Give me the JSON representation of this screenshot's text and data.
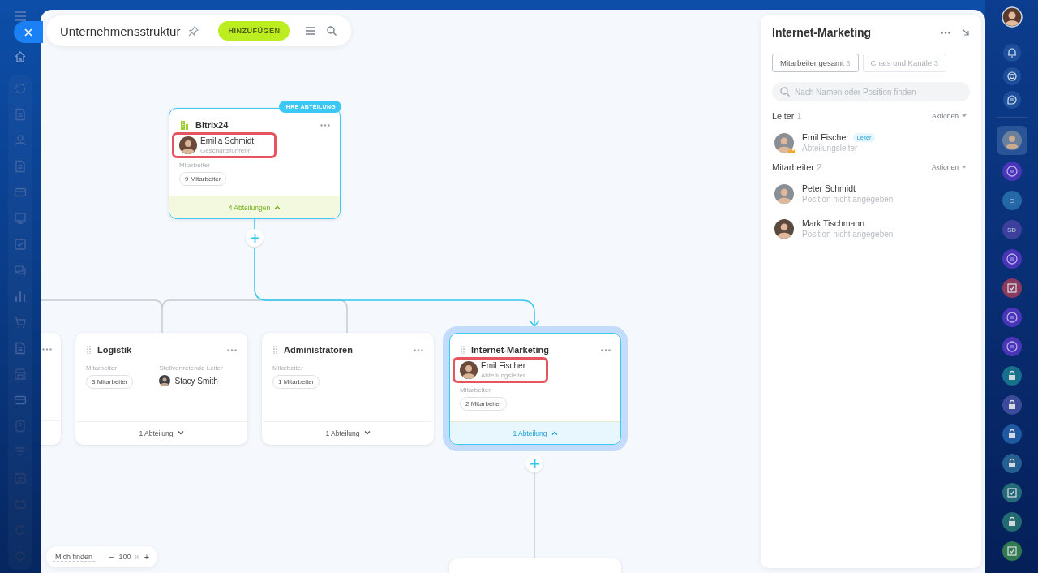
{
  "header": {
    "title": "Unternehmensstruktur",
    "add_button": "HINZUFÜGEN"
  },
  "nodes": [
    {
      "kind": "root",
      "title": "Bitrix24",
      "badge": "IHRE ABTEILUNG",
      "head": {
        "name": "Emilia Schmidt",
        "position": "Geschäftsführerin",
        "highlighted": true
      },
      "employees_label": "Mitarbeiter",
      "employees": "9 Mitarbeiter",
      "footer": "4 Abteilungen",
      "expanded": true,
      "selected": false
    },
    {
      "kind": "cut",
      "more_menu": true
    },
    {
      "kind": "department",
      "title": "Logistik",
      "employees_label": "Mitarbeiter",
      "employees": "3 Mitarbeiter",
      "deputy_label": "Stellvertretende Leiter",
      "deputy": "Stacy Smith",
      "footer": "1 Abteilung",
      "expanded": false,
      "selected": false
    },
    {
      "kind": "department",
      "title": "Administratoren",
      "employees_label": "Mitarbeiter",
      "employees": "1 Mitarbeiter",
      "footer": "1 Abteilung",
      "expanded": false,
      "selected": false
    },
    {
      "kind": "department",
      "title": "Internet-Marketing",
      "head": {
        "name": "Emil Fischer",
        "position": "Abteilungsleiter",
        "highlighted": true
      },
      "employees_label": "Mitarbeiter",
      "employees": "2 Mitarbeiter",
      "footer": "1 Abteilung",
      "expanded": true,
      "selected": true
    },
    {
      "kind": "cut"
    }
  ],
  "zoom": {
    "find_me": "Mich finden",
    "minus": "−",
    "value": "100",
    "unit": "%",
    "plus": "+"
  },
  "panel": {
    "title": "Internet-Marketing",
    "tabs": [
      {
        "label": "Mitarbeiter gesamt",
        "count": "3",
        "selected": true
      },
      {
        "label": "Chats und Kanäle",
        "count": "3",
        "selected": false
      }
    ],
    "search": {
      "placeholder": "Nach Namen oder Position finden"
    },
    "sections": [
      {
        "title": "Leiter",
        "count": "1",
        "action": "Aktionen",
        "people": [
          {
            "name": "Emil Fischer",
            "tag": "Leiter",
            "position": "Abteilungsleiter",
            "crown": true
          }
        ]
      },
      {
        "title": "Mitarbeiter",
        "count": "2",
        "action": "Aktionen",
        "people": [
          {
            "name": "Peter Schmidt",
            "position": "Position nicht angegeben",
            "crown": false
          },
          {
            "name": "Mark Tischmann",
            "position": "Position nicht angegeben",
            "crown": false
          }
        ]
      }
    ]
  },
  "right_rail": [
    {
      "kind": "avatar",
      "color": "#6a7f9c",
      "selected": true
    },
    {
      "kind": "chat",
      "color": "#4a35b8",
      "selected": false
    },
    {
      "kind": "letters",
      "label": "C",
      "color": "#2468a8",
      "selected": false
    },
    {
      "kind": "letters",
      "label": "SD",
      "color": "#3d3f9c",
      "selected": false
    },
    {
      "kind": "chat",
      "color": "#4a35b8",
      "selected": false
    },
    {
      "kind": "task",
      "color": "#8a3a5c",
      "selected": false
    },
    {
      "kind": "chat",
      "color": "#4a35b8",
      "selected": false
    },
    {
      "kind": "chat",
      "color": "#4a35b8",
      "selected": false
    },
    {
      "kind": "lock",
      "color": "#16708c",
      "selected": false
    },
    {
      "kind": "lock",
      "color": "#3c4a9c",
      "selected": false
    },
    {
      "kind": "lock",
      "color": "#1f5aa0",
      "selected": false
    },
    {
      "kind": "lock",
      "color": "#245f90",
      "selected": false
    },
    {
      "kind": "task",
      "color": "#246a78",
      "selected": false
    },
    {
      "kind": "lock",
      "color": "#236a70",
      "selected": false
    },
    {
      "kind": "task",
      "color": "#2f7a4e",
      "selected": false
    }
  ]
}
